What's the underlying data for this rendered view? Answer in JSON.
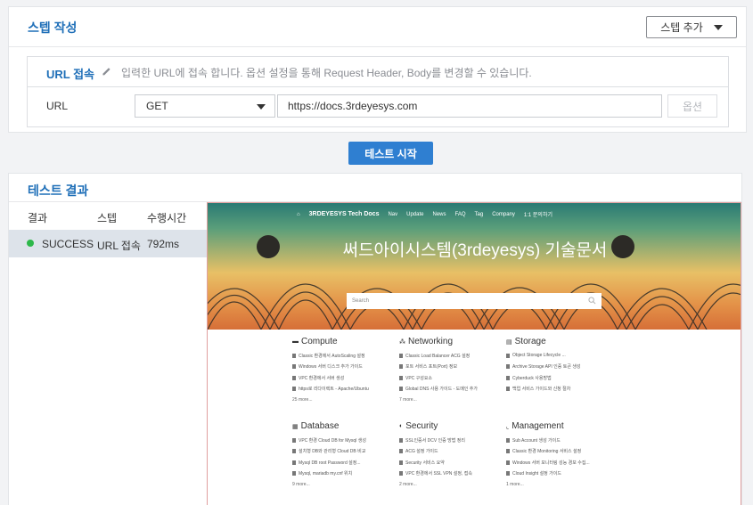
{
  "step": {
    "title": "스텝 작성",
    "add_button": "스텝 추가",
    "url_section": {
      "title": "URL 접속",
      "description": "입력한 URL에 접속 합니다. 옵션 설정을 통해 Request Header, Body를 변경할 수 있습니다.",
      "url_label": "URL",
      "method": "GET",
      "url_value": "https://docs.3rdeyesys.com",
      "option_button": "옵션"
    }
  },
  "start_button": "테스트 시작",
  "result": {
    "title": "테스트 결과",
    "columns": [
      "결과",
      "스텝",
      "수행시간"
    ],
    "rows": [
      {
        "status": "SUCCESS",
        "step": "URL 접속",
        "duration": "792ms",
        "status_color": "#2db84a"
      }
    ]
  },
  "preview": {
    "nav": {
      "brand": "3RDEYESYS Tech Docs",
      "items": [
        "Nav",
        "Update",
        "News",
        "FAQ",
        "Tag",
        "Company",
        "1:1 문의하기"
      ]
    },
    "hero_title": "써드아이시스템(3rdeyesys) 기술문서",
    "search_placeholder": "Search",
    "categories": [
      {
        "title": "Compute",
        "icon": "server-icon",
        "items": [
          "Classic 환경에서 AutoScaling 설정",
          "Windows 서버 디스크 추가 가이드",
          "VPC 환경에서 서버 생성",
          "https로 리다이렉트 - Apache/Ubuntu"
        ],
        "more": "25 more..."
      },
      {
        "title": "Networking",
        "icon": "network-icon",
        "items": [
          "Classic Load Balancer ACG 설정",
          "포트 서비스 포트(Port) 정보",
          "VPC 구성요소",
          "Global DNS 사용 가이드 - 도메인 추가"
        ],
        "more": "7 more..."
      },
      {
        "title": "Storage",
        "icon": "storage-icon",
        "items": [
          "Object Storage Lifecycle ...",
          "Archive Storage API 인증 토큰 생성",
          "Cyberduck 사용방법",
          "백업 서비스 가이드와 신청 절차"
        ],
        "more": ""
      },
      {
        "title": "Database",
        "icon": "database-icon",
        "items": [
          "VPC 환경 Cloud DB for Mysql 생성",
          "설치형 DB와 관리형 Cloud DB 비교",
          "Mysql DB root Password 설정...",
          "Mysql, mariadb my.cnf 위치"
        ],
        "more": "9 more..."
      },
      {
        "title": "Security",
        "icon": "shield-icon",
        "items": [
          "SSL인증서 DCV 인증 방법 정리",
          "ACG 설정 가이드",
          "Security 서비스 요약",
          "VPC 환경에서 SSL VPN 설정, 접속"
        ],
        "more": "2 more..."
      },
      {
        "title": "Management",
        "icon": "chart-icon",
        "items": [
          "Sub Account 생성 가이드",
          "Classic 환경 Monitoring 서비스 설정",
          "Windows 서버 모니터링 성능 경보 수집...",
          "Cloud Insight 설정 가이드"
        ],
        "more": "1 more..."
      }
    ]
  }
}
